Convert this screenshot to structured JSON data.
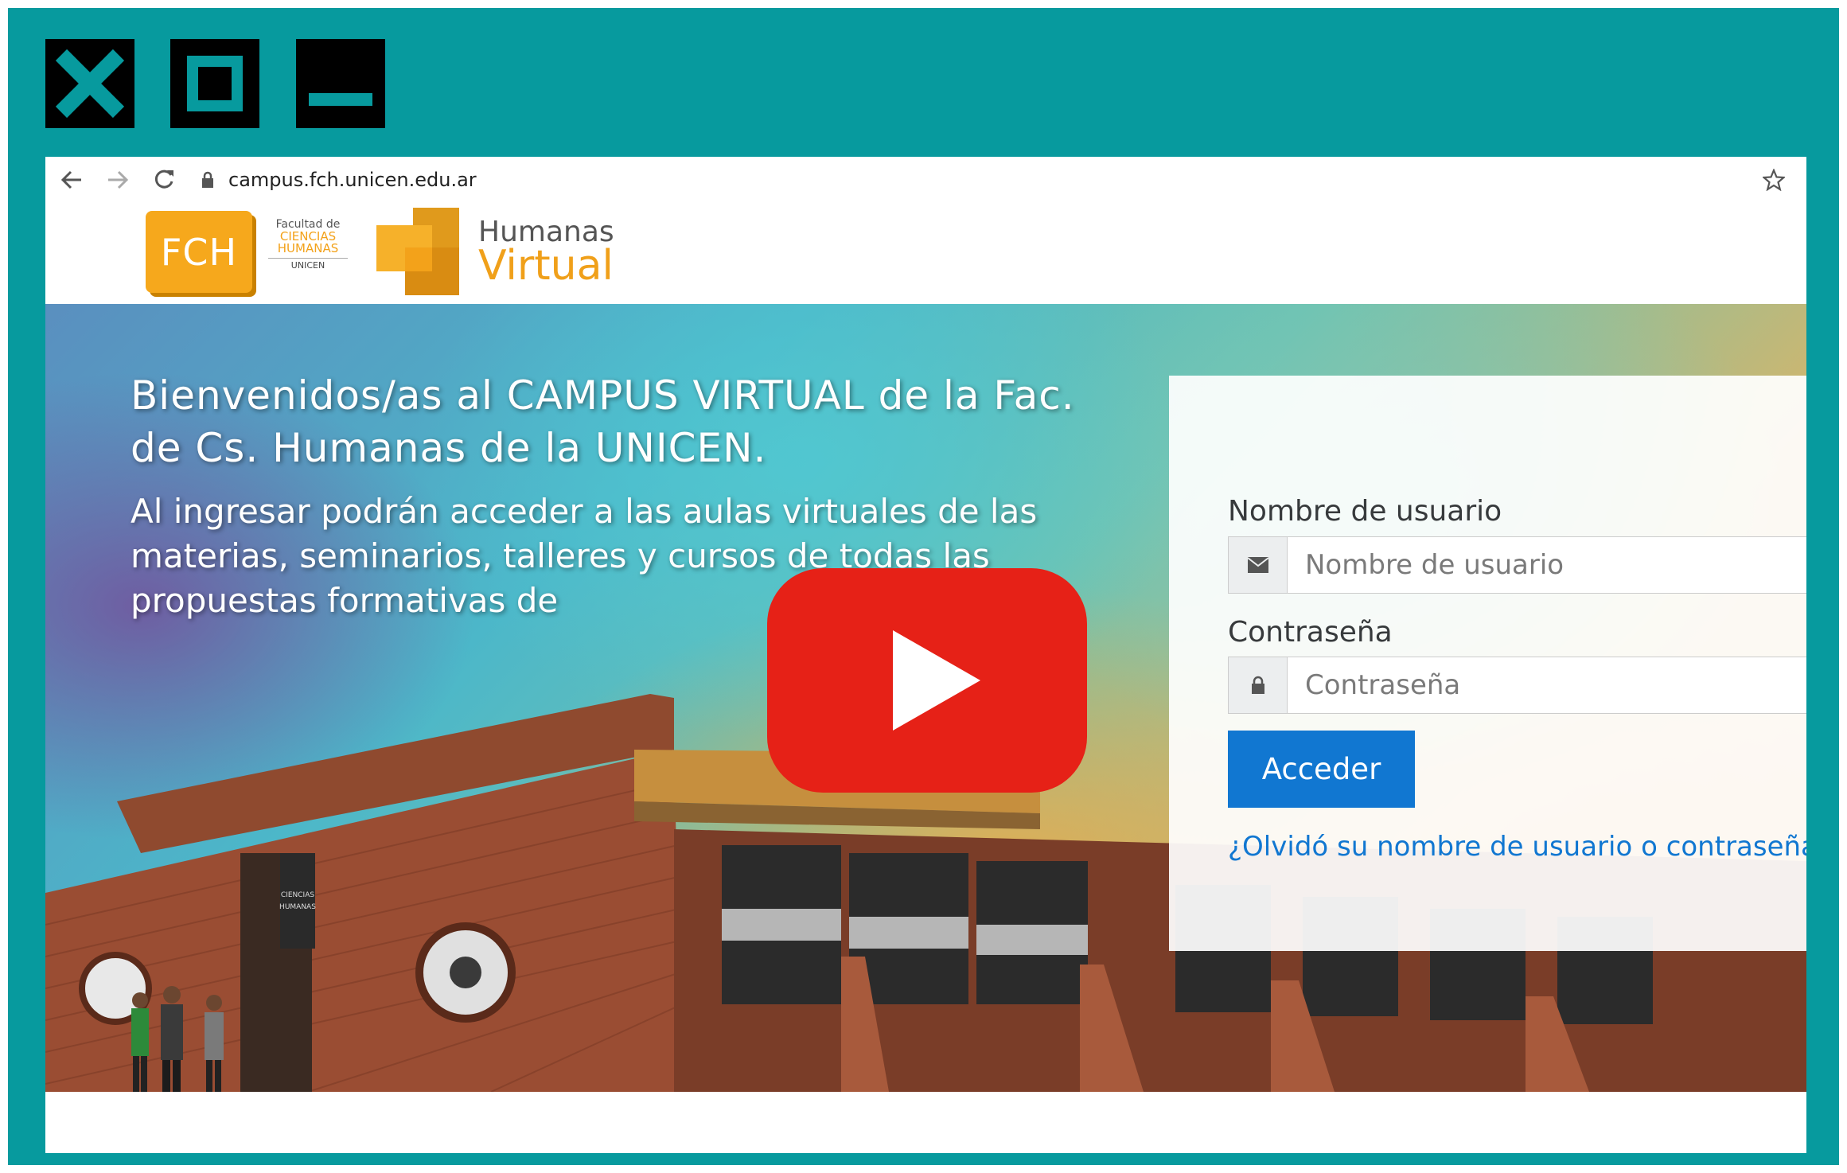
{
  "browser": {
    "url": "campus.fch.unicen.edu.ar"
  },
  "header": {
    "fch_logo_text": "FCH",
    "fch_sub": [
      "Facultad de",
      "CIENCIAS",
      "HUMANAS",
      "UNICEN"
    ],
    "hv_line1": "Humanas",
    "hv_line2": "Virtual"
  },
  "hero": {
    "title": "Bienvenidos/as al CAMPUS VIRTUAL de la Fac. de Cs. Humanas de la UNICEN.",
    "description": "Al ingresar podrán acceder a las aulas virtuales de las materias, seminarios, talleres y cursos de todas las propuestas formativas de"
  },
  "building": {
    "sign_line1": "CIENCIAS",
    "sign_line2": "HUMANAS"
  },
  "login": {
    "username_label": "Nombre de usuario",
    "username_placeholder": "Nombre de usuario",
    "password_label": "Contraseña",
    "password_placeholder": "Contraseña",
    "submit_label": "Acceder",
    "forgot_link": "¿Olvidó su nombre de usuario o contraseña?"
  },
  "colors": {
    "frame_bg": "#079a9e",
    "login_button": "#1177d1",
    "youtube_red": "#e62117",
    "logo_orange": "#f6a81c"
  },
  "icons": [
    "close-icon",
    "maximize-icon",
    "minimize-icon",
    "back-arrow-icon",
    "forward-arrow-icon",
    "reload-icon",
    "lock-icon",
    "star-icon",
    "envelope-icon",
    "padlock-icon",
    "youtube-play-icon"
  ]
}
